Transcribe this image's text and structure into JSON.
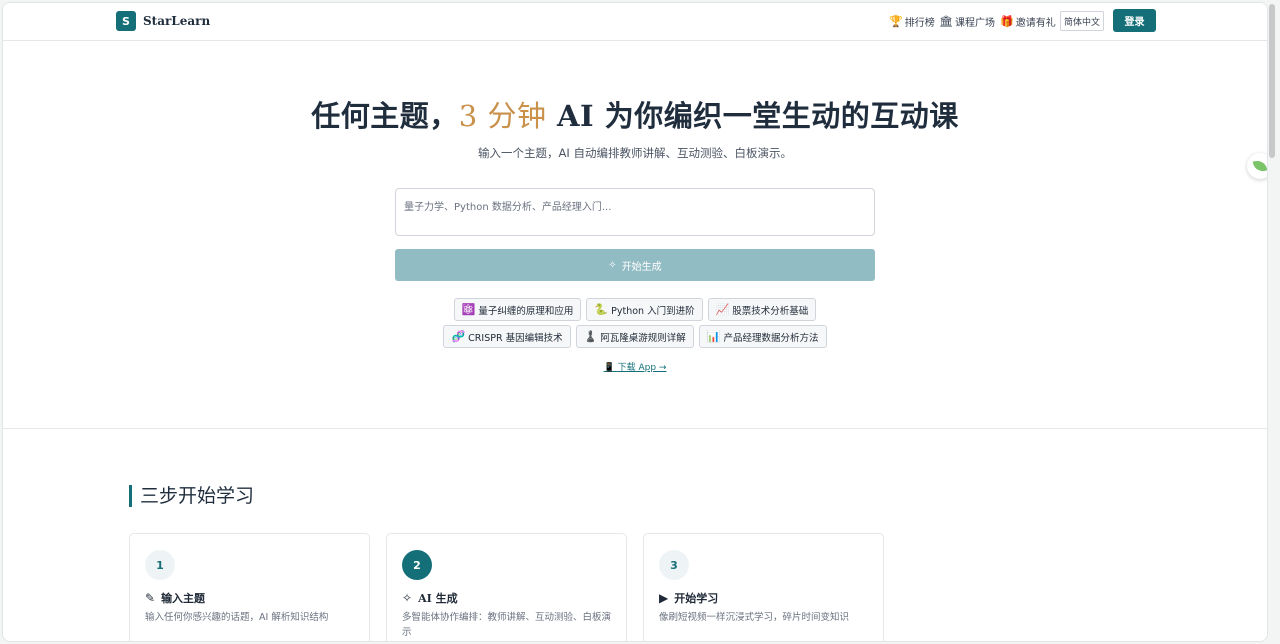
{
  "header": {
    "logo_letter": "S",
    "brand": "StarLearn",
    "nav": [
      {
        "icon": "🏆",
        "label": "排行榜"
      },
      {
        "icon": "🏛",
        "label": "课程广场"
      },
      {
        "icon": "🎁",
        "label": "邀请有礼"
      }
    ],
    "language": "简体中文",
    "login": "登录"
  },
  "hero": {
    "title_pre": "任何主题，",
    "title_accent": "3 分钟",
    "title_post": " AI 为你编织一堂生动的互动课",
    "subtitle": "输入一个主题，AI 自动编排教师讲解、互动测验、白板演示。",
    "input_placeholder": "量子力学、Python 数据分析、产品经理入门...",
    "input_value": "",
    "generate_label": "开始生成"
  },
  "suggestions": [
    {
      "icon": "⚛️",
      "label": "量子纠缠的原理和应用"
    },
    {
      "icon": "🐍",
      "label": "Python 入门到进阶"
    },
    {
      "icon": "📈",
      "label": "股票技术分析基础"
    },
    {
      "icon": "🧬",
      "label": "CRISPR 基因编辑技术"
    },
    {
      "icon": "♟️",
      "label": "阿瓦隆桌游规则详解"
    },
    {
      "icon": "📊",
      "label": "产品经理数据分析方法"
    }
  ],
  "download": {
    "icon": "📱",
    "label": "下载 App →"
  },
  "steps": {
    "title": "三步开始学习",
    "items": [
      {
        "number": "1",
        "icon": "✎",
        "title": "输入主题",
        "description": "输入任何你感兴趣的话题，AI 解析知识结构"
      },
      {
        "number": "2",
        "icon": "✧",
        "title": "AI 生成",
        "description": "多智能体协作编排：教师讲解、互动测验、白板演示"
      },
      {
        "number": "3",
        "icon": "▶",
        "title": "开始学习",
        "description": "像刷短视频一样沉浸式学习，碎片时间变知识"
      }
    ]
  },
  "colors": {
    "accent": "#156f78",
    "highlight": "#c9914a",
    "button_disabled": "#91bcc3"
  }
}
